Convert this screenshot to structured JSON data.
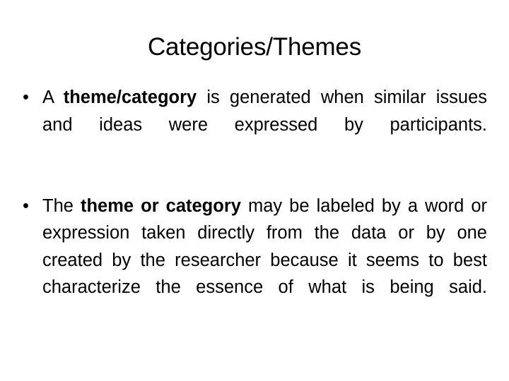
{
  "slide": {
    "title": "Categories/Themes",
    "bullet_marker": "•",
    "bullets": [
      {
        "prefix": "A ",
        "bold": "theme/category",
        "suffix": " is generated when similar issues and ideas were expressed by participants.",
        "full_text": "A theme/category is generated when similar issues and ideas were expressed by participants."
      },
      {
        "prefix": "The ",
        "bold": "theme or category",
        "suffix": " may be labeled by a word or expression taken directly from the data or by one created by the researcher because it seems to best characterize the essence of what is being said.",
        "full_text": "The theme or category may be labeled by a word or expression taken directly from the data or by one created by the researcher because it seems to best characterize the essence of what is being said."
      }
    ]
  },
  "colors": {
    "background": "#ffffff",
    "text": "#000000"
  }
}
